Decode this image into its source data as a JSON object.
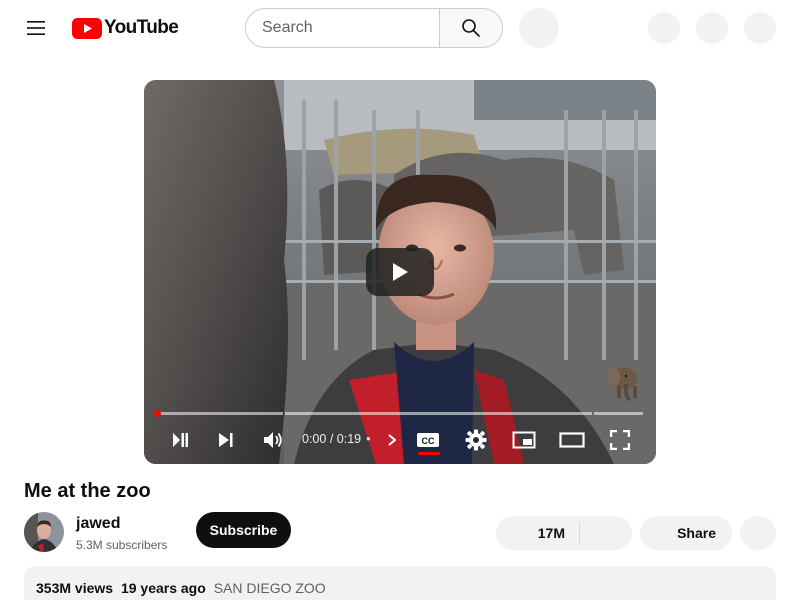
{
  "header": {
    "menu_icon": "hamburger-menu-icon",
    "logo_text": "YouTube",
    "logo_color": "#ff0000",
    "search": {
      "placeholder": "Search",
      "value": ""
    },
    "search_icon": "search-icon"
  },
  "player": {
    "time_current": "0:00",
    "time_separator": "/",
    "time_total": "0:19",
    "progress_played_fraction": 0.0,
    "accent_color": "#ff0000",
    "controls": [
      "play-icon",
      "next-icon",
      "volume-icon",
      "chevron-right-icon",
      "closed-captions-icon",
      "settings-gear-icon",
      "miniplayer-icon",
      "theater-mode-icon",
      "fullscreen-icon"
    ],
    "watermark_icon": "elephant-icon"
  },
  "video": {
    "title": "Me at the zoo"
  },
  "channel": {
    "name": "jawed",
    "subscribers": "5.3M subscribers",
    "subscribe_label": "Subscribe"
  },
  "actions": {
    "like_count": "17M",
    "share_label": "Share"
  },
  "description": {
    "views": "353M views",
    "date": "19 years ago",
    "tag": "SAN DIEGO ZOO"
  }
}
